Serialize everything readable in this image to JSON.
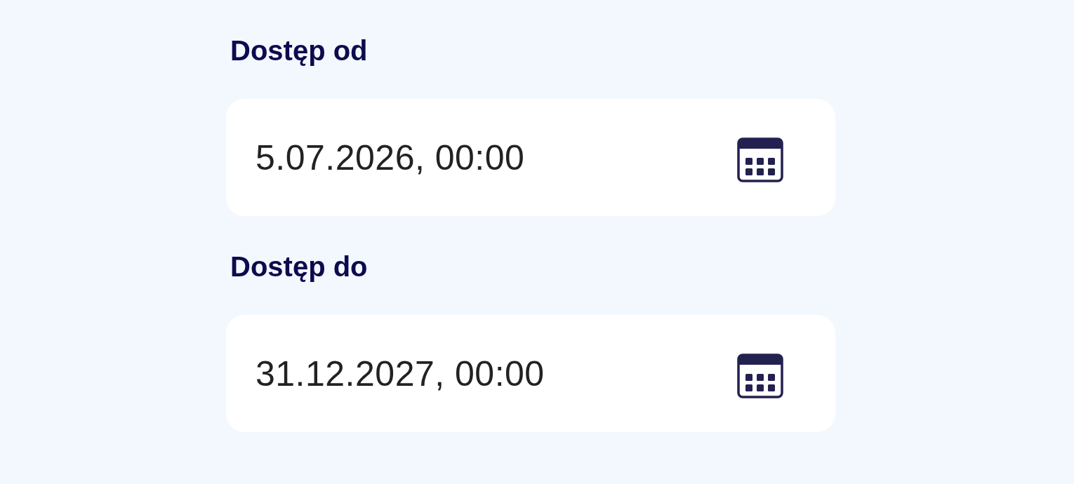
{
  "fields": [
    {
      "label": "Dostęp od",
      "value": "5.07.2026, 00:00"
    },
    {
      "label": "Dostęp do",
      "value": "31.12.2027, 00:00"
    }
  ]
}
